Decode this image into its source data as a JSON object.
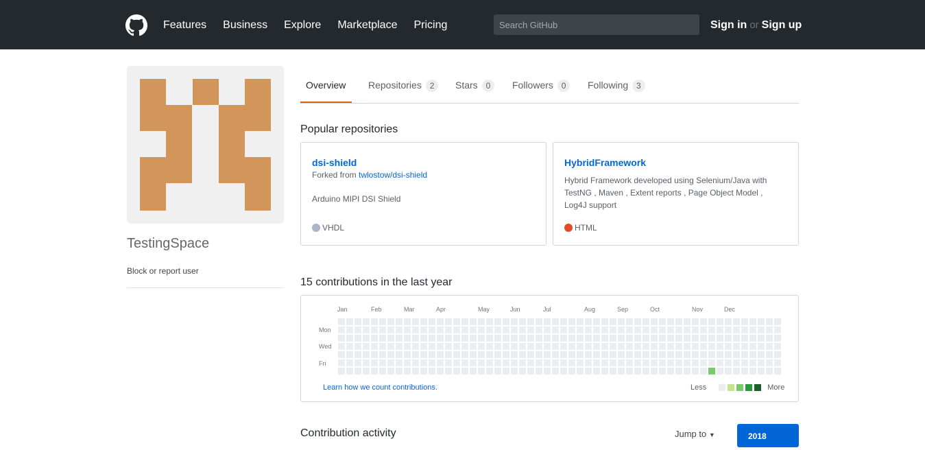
{
  "header": {
    "nav": [
      "Features",
      "Business",
      "Explore",
      "Marketplace",
      "Pricing"
    ],
    "search_placeholder": "Search GitHub",
    "sign_in": "Sign in",
    "or": "or",
    "sign_up": "Sign up"
  },
  "profile": {
    "username": "TestingSpace",
    "block_link": "Block or report user",
    "avatar_color": "#d3965a"
  },
  "tabs": [
    {
      "label": "Overview",
      "count": null,
      "selected": true
    },
    {
      "label": "Repositories",
      "count": "2"
    },
    {
      "label": "Stars",
      "count": "0"
    },
    {
      "label": "Followers",
      "count": "0"
    },
    {
      "label": "Following",
      "count": "3"
    }
  ],
  "popular": {
    "title": "Popular repositories",
    "repos": [
      {
        "name": "dsi-shield",
        "forked_prefix": "Forked from ",
        "forked_from": "twlostow/dsi-shield",
        "description": "Arduino MIPI DSI Shield",
        "language": "VHDL",
        "language_color": "#adb2cb"
      },
      {
        "name": "HybridFramework",
        "description": "Hybrid Framework developed using Selenium/Java with TestNG , Maven , Extent reports , Page Object Model , Log4J support",
        "language": "HTML",
        "language_color": "#e34c26"
      }
    ]
  },
  "contributions": {
    "title": "15 contributions in the last year",
    "months": [
      "Jan",
      "Feb",
      "Mar",
      "Apr",
      "May",
      "Jun",
      "Jul",
      "Aug",
      "Sep",
      "Oct",
      "Nov",
      "Dec"
    ],
    "weekdays": [
      "Mon",
      "Wed",
      "Fri"
    ],
    "learn_link": "Learn how we count contributions.",
    "legend_less": "Less",
    "legend_more": "More",
    "colors": [
      "#ebedf0",
      "#c6e48b",
      "#7bc96f",
      "#239a3b",
      "#196127"
    ]
  },
  "activity": {
    "title": "Contribution activity",
    "jump_to": "Jump to",
    "year": "2018"
  }
}
